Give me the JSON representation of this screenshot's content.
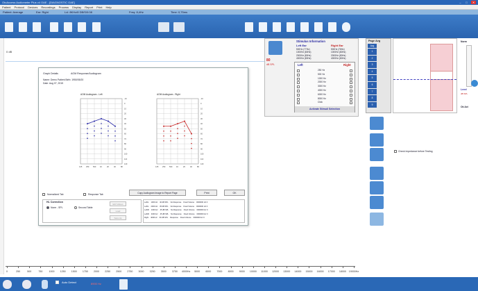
{
  "titlebar": {
    "title": "OtoAccess Audiometer Plus v4 OAE - [DIAGNOSTIC OAE]",
    "min": "–",
    "max": "□",
    "close": "✕"
  },
  "menu": [
    "Patient",
    "Protocol",
    "Devices",
    "Recordings",
    "Process",
    "Display",
    "Report",
    "Print",
    "Help"
  ],
  "infobar": {
    "patient": "Patient: Average",
    "ear": "Ear: Right",
    "freq": "Freq: 8,4Hz",
    "level": "Lvl: 8KHz/8 DB/S/0:08",
    "time": "Time: 0,75ms"
  },
  "graph": {
    "ylabel": "0 dB",
    "xticks": [
      "0",
      "250",
      "500",
      "750",
      "1000",
      "1250",
      "1500",
      "1750",
      "2000",
      "2250",
      "2500",
      "2750",
      "3000",
      "3250",
      "3500",
      "3750",
      "4000Hz",
      "5000",
      "6000",
      "7000",
      "8000",
      "9000",
      "10000",
      "11000",
      "12000",
      "13000",
      "14000",
      "15000",
      "16000",
      "17000",
      "18000",
      "19000Hz"
    ]
  },
  "dialog": {
    "title1": "Graph Details",
    "title2": "AOM Response/Audiogram",
    "patient": "Name: Demo Patient  Birth: 1950/05/20",
    "date": "Date: Aug 07, 2015",
    "left_title": "AOM Audiogram - Left",
    "right_title": "AOM Audiogram - Right",
    "yticks": [
      "-10",
      "0",
      "10",
      "20",
      "30",
      "40",
      "50",
      "60",
      "70",
      "80",
      "90",
      "100",
      "110",
      "120"
    ],
    "xticks": [
      "125",
      "250",
      "500",
      "1K",
      "2K",
      "4K",
      "8K"
    ],
    "left_line_color": "#2828a8",
    "right_line_color": "#c82828",
    "left_values": [
      null,
      40,
      35,
      30,
      35,
      45,
      null
    ],
    "right_values": [
      null,
      45,
      45,
      40,
      35,
      60,
      null
    ],
    "checkbox_normalized": "Normalized Tab",
    "checkbox_response": "Response Tab",
    "copy_button": "Copy Audiogram Image to Report Page",
    "print_button": "Print",
    "ok_button": "OK",
    "correction_title": "HL Correction",
    "radio_none": "None - SPL",
    "radio_second": "Second Table",
    "btn_edit": "Edit Values",
    "btn_load": "Load",
    "btn_save": "Save As",
    "table": [
      [
        "Left/L",
        "1000 Hz",
        "40 dB SPL",
        "No Response",
        "Fixed Volume",
        "0000000 Hz 0"
      ],
      [
        "Left/L",
        "2000 Hz",
        "35 dB SPL",
        "No Response",
        "Fixed Volume",
        "0000000 Hz 0"
      ],
      [
        "Left/R",
        "1000 Hz",
        "45 dB SPL",
        "No Response",
        "Fixed Volume",
        "0000000 Hz 0"
      ],
      [
        "Left/R",
        "4000 Hz",
        "45 dB SPL",
        "No Response",
        "Fixed Volume",
        "0000000 Hz 0"
      ],
      [
        "Right",
        "4000 Hz",
        "60 dB SPL",
        "Response",
        "Fixed Volume",
        "0000000 Hz 0"
      ]
    ]
  },
  "stimulus": {
    "heading": "Stimulus Information",
    "left_ear": "Left Ear",
    "right_ear": "Right Ear",
    "level": "80",
    "level_unit": "dB SPL",
    "rows_left": [
      "500Hz (77Hz)",
      "1000Hz (80Hz)",
      "2000Hz (80Hz)",
      "4000Hz (80Hz)"
    ],
    "rows_right": [
      "500Hz (78Hz)",
      "1000Hz (80Hz)",
      "2000Hz (80Hz)",
      "4000Hz (80Hz)"
    ],
    "col_left": "Left",
    "col_right": "Right",
    "freqs": [
      "250 Hz",
      "500 Hz",
      "1000 Hz",
      "2000 Hz",
      "3000 Hz",
      "4000 Hz",
      "6000 Hz",
      "8000 Hz",
      "Click"
    ],
    "footer": "Activate  Stimuli Selection"
  },
  "pageavg": {
    "title": "Page Avg",
    "selected": "Avg",
    "pages": [
      "1",
      "2",
      "3",
      "4",
      "5",
      "6",
      "7",
      "8",
      "9"
    ]
  },
  "rightpanel": {
    "norm": "Norm",
    "level": "Level",
    "dbspl": "dB SPL",
    "ok": "Ok Act"
  },
  "impedance": {
    "label": "Check Impedance before Testing"
  },
  "status": {
    "text1": "Auto Detect",
    "text2": "8900 Hz",
    "accent": "#e03030"
  }
}
